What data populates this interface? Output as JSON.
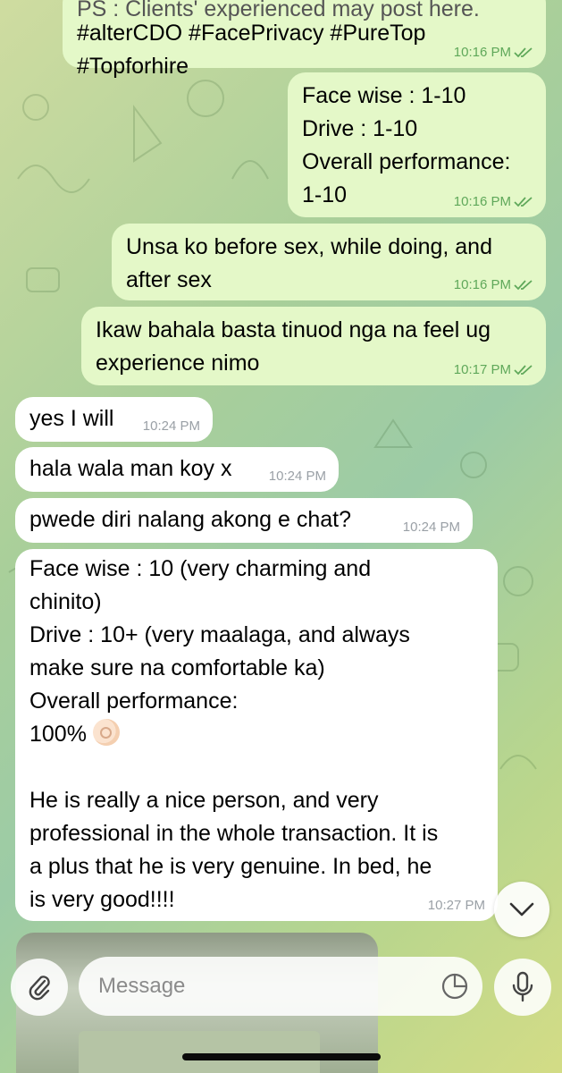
{
  "top_message": {
    "partial_line": "PS : Clients' experienced may post here.",
    "hashtags": "#alterCDO #FacePrivacy #PureTop #Topforhire",
    "time": "10:16 PM"
  },
  "messages": [
    {
      "direction": "out",
      "text": "Face wise : 1-10\nDrive : 1-10\nOverall performance:\n1-10",
      "time": "10:16 PM"
    },
    {
      "direction": "out",
      "text": "Unsa ko before sex, while doing, and\nafter sex",
      "time": "10:16 PM"
    },
    {
      "direction": "out",
      "text": "Ikaw bahala basta tinuod nga na feel ug\nexperience nimo",
      "time": "10:17 PM"
    },
    {
      "direction": "in",
      "text": "yes I will",
      "time": "10:24 PM"
    },
    {
      "direction": "in",
      "text": "hala wala man koy x",
      "time": "10:24 PM"
    },
    {
      "direction": "in",
      "text": "pwede diri nalang akong e chat?",
      "time": "10:24 PM"
    },
    {
      "direction": "in",
      "text_before_emoji": "Face wise : 10 (very charming and\nchinito)\nDrive : 10+ (very maalaga, and always\nmake sure na comfortable ka)\nOverall performance:\n100% ",
      "emoji": "ok-hand-emoji",
      "text_after_emoji": "\n\nHe is really a nice person, and very\nprofessional in the whole transaction. It is\na plus that he is very genuine. In bed, he\nis very good!!!!",
      "time": "10:27 PM"
    }
  ],
  "input": {
    "placeholder": "Message",
    "value": ""
  },
  "icons": {
    "attach": "paperclip-icon",
    "sticker": "sticker-icon",
    "mic": "microphone-icon",
    "scroll": "chevron-down-icon",
    "read": "double-check-icon"
  },
  "colors": {
    "outgoing_bubble": "#e4f8c8",
    "incoming_bubble": "#ffffff",
    "outgoing_meta": "#5fa85a",
    "incoming_meta": "#9aa0a6"
  }
}
